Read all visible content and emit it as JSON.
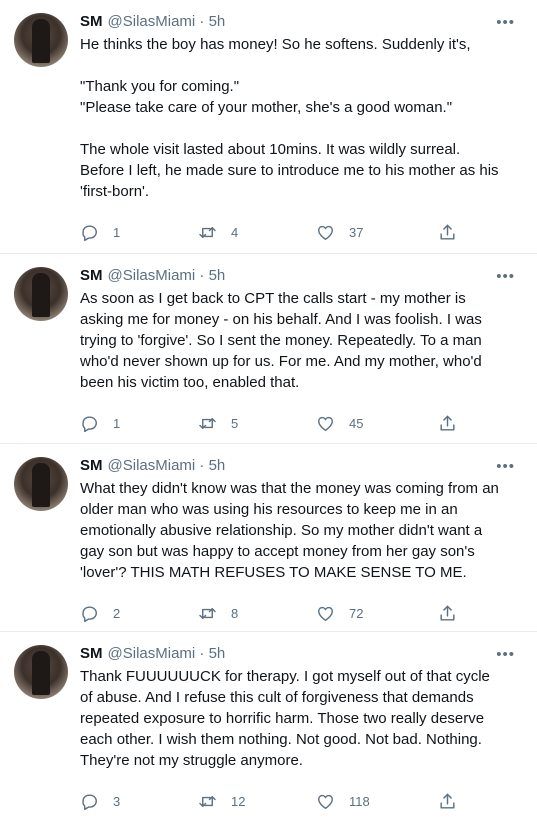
{
  "tweets": [
    {
      "name": "SM",
      "handle": "@SilasMiami · 5h",
      "text": "He thinks the boy has money! So he softens. Suddenly it's,\n\n\"Thank you for coming.\"\n\"Please take care of your mother, she's a good woman.\"\n\nThe whole visit lasted about 10mins. It was wildly surreal. Before I left, he made sure to introduce me to his mother as his 'first-born'.",
      "replies": "1",
      "retweets": "4",
      "likes": "37"
    },
    {
      "name": "SM",
      "handle": "@SilasMiami · 5h",
      "text": "As soon as I get back to CPT the calls start - my mother is asking me for money - on his behalf. And I was foolish. I was trying to 'forgive'. So I sent the money. Repeatedly. To a man who'd never shown up for us. For me. And my mother, who'd been his victim too, enabled that.",
      "replies": "1",
      "retweets": "5",
      "likes": "45"
    },
    {
      "name": "SM",
      "handle": "@SilasMiami · 5h",
      "text": "What they didn't know was that the money was coming from an older man who was using his resources to keep me in an emotionally abusive relationship. So my mother didn't want a gay son but was happy to accept money from her gay son's 'lover'? THIS MATH REFUSES TO MAKE SENSE TO ME.",
      "replies": "2",
      "retweets": "8",
      "likes": "72"
    },
    {
      "name": "SM",
      "handle": "@SilasMiami · 5h",
      "text": "Thank FUUUUUUCK for therapy. I got myself out of that cycle of abuse. And I refuse this cult of forgiveness that demands repeated exposure to horrific harm. Those two really deserve each other. I wish them nothing. Not good. Not bad. Nothing. They're not my struggle anymore.",
      "replies": "3",
      "retweets": "12",
      "likes": "118"
    }
  ],
  "icons": {
    "more": "more-dots-icon",
    "reply": "reply-icon",
    "retweet": "retweet-icon",
    "like": "heart-icon",
    "share": "share-icon"
  },
  "colors": {
    "text": "#0f1419",
    "secondary": "#5b7083",
    "divider": "#e6ecf0"
  }
}
